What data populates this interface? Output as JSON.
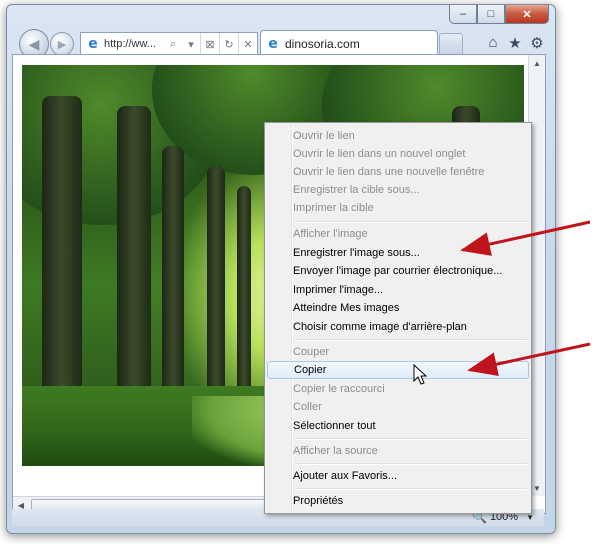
{
  "window": {
    "caption_minimize": "–",
    "caption_maximize": "□",
    "caption_close": "✕"
  },
  "nav": {
    "back_glyph": "◀",
    "forward_glyph": "▶",
    "address_text": "http://ww...",
    "address_search_glyph": "⌕",
    "address_dropdown_glyph": "▾",
    "compat_glyph": "⊠",
    "refresh_glyph": "↻",
    "stop_glyph": "✕",
    "ie_glyph": "e"
  },
  "tab": {
    "title": "dinosoria.com"
  },
  "toolbar": {
    "home_glyph": "⌂",
    "favorites_glyph": "★",
    "tools_glyph": "⚙"
  },
  "menu": {
    "group1": [
      "Ouvrir le lien",
      "Ouvrir le lien dans un nouvel onglet",
      "Ouvrir le lien dans une nouvelle fenêtre",
      "Enregistrer la cible sous...",
      "Imprimer la cible"
    ],
    "group2": [
      "Afficher l'image",
      "Enregistrer l'image sous...",
      "Envoyer l'image par courrier électronique...",
      "Imprimer l'image...",
      "Atteindre Mes images",
      "Choisir comme image d'arrière-plan"
    ],
    "group3": [
      "Couper",
      "Copier",
      "Copier le raccourci",
      "Coller",
      "Sélectionner tout"
    ],
    "group4": [
      "Afficher la source"
    ],
    "group5": [
      "Ajouter aux Favoris..."
    ],
    "group6": [
      "Propriétés"
    ]
  },
  "status": {
    "zoom": "100%",
    "zoom_glyph": "🔍",
    "zoom_chevron": "▼"
  },
  "scroll": {
    "up": "▲",
    "down": "▼",
    "left": "◀"
  },
  "colors": {
    "arrow": "#c0141c",
    "menu_highlight": "#dfecfa"
  },
  "icons": {
    "cursor": "arrow-pointer-icon"
  }
}
